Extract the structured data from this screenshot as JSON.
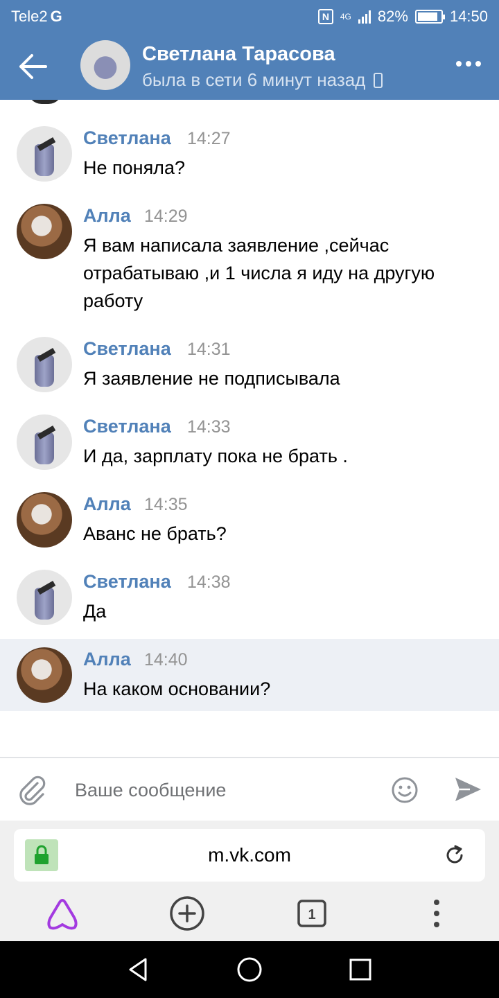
{
  "status_bar": {
    "carrier": "Tele2",
    "network_letter": "G",
    "nfc": "N",
    "network_type": "4G",
    "battery": "82%",
    "time": "14:50"
  },
  "header": {
    "name": "Светлана Тарасова",
    "status": "была в сети 6 минут назад"
  },
  "messages": [
    {
      "author": "Светлана",
      "time": "14:27",
      "text": "Не поняла?"
    },
    {
      "author": "Алла",
      "time": "14:29",
      "text": "Я вам написала заявление ,сейчас отрабатываю ,и 1 числа я иду на другую работу"
    },
    {
      "author": "Светлана",
      "time": "14:31",
      "text": "Я заявление не подписывала"
    },
    {
      "author": "Светлана",
      "time": "14:33",
      "text": "И да, зарплату пока не брать ."
    },
    {
      "author": "Алла",
      "time": "14:35",
      "text": "Аванс не брать?"
    },
    {
      "author": "Светлана",
      "time": "14:38",
      "text": "Да"
    },
    {
      "author": "Алла",
      "time": "14:40",
      "text": "На каком основании?"
    }
  ],
  "composer": {
    "placeholder": "Ваше сообщение"
  },
  "browser": {
    "url": "m.vk.com",
    "tab_count": "1"
  },
  "colors": {
    "vk_blue": "#5181b8",
    "highlight": "#edf0f5",
    "alice_purple": "#a33ae0"
  }
}
